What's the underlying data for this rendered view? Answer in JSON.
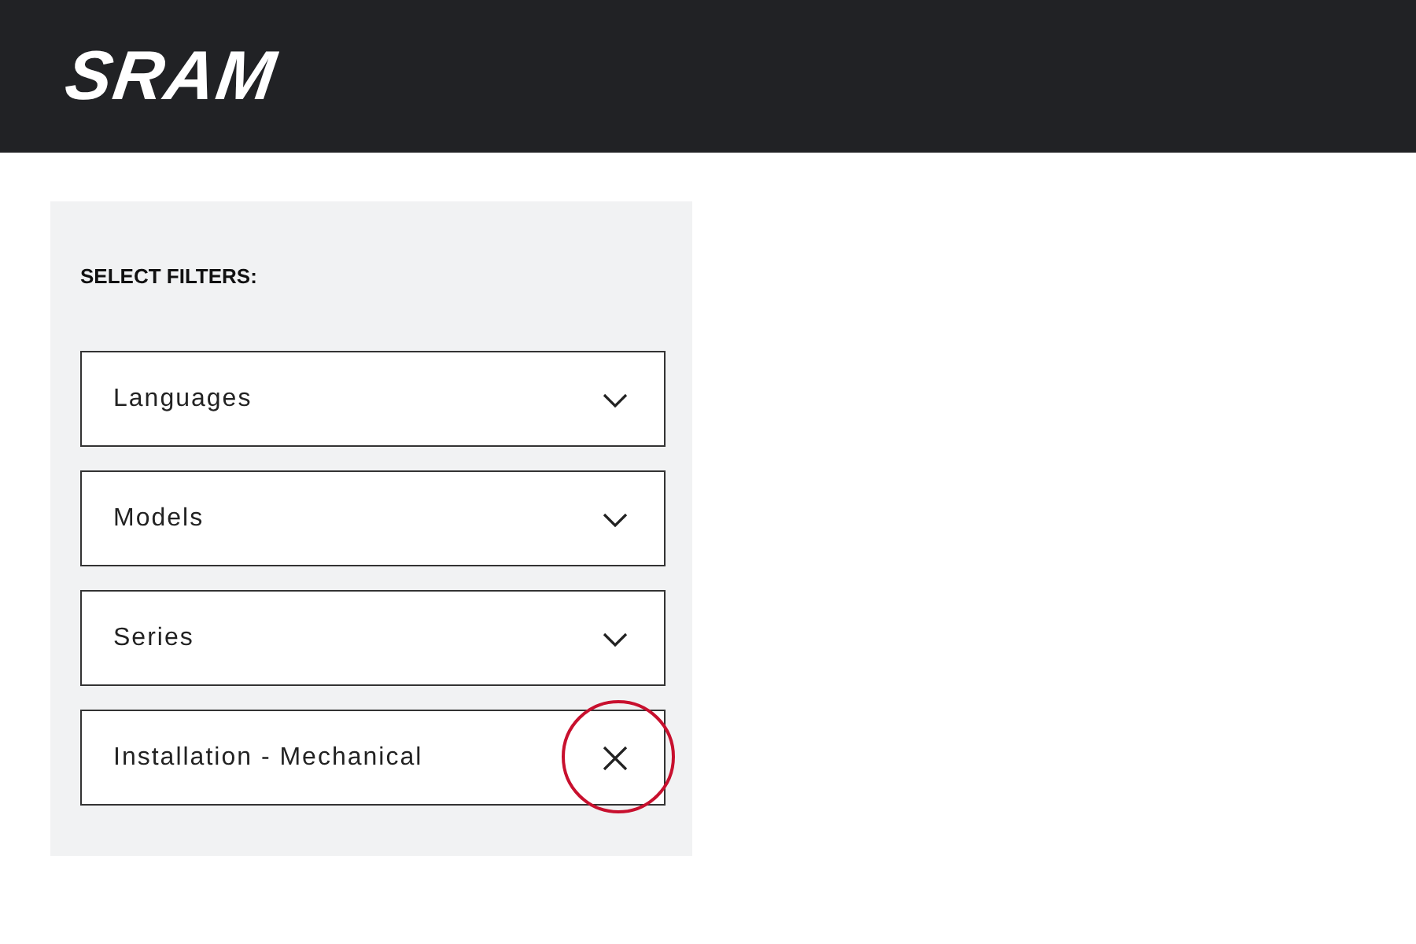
{
  "header": {
    "logo": "SRAM"
  },
  "filters": {
    "heading": "SELECT FILTERS:",
    "items": [
      {
        "label": "Languages",
        "kind": "dropdown"
      },
      {
        "label": "Models",
        "kind": "dropdown"
      },
      {
        "label": "Series",
        "kind": "dropdown"
      },
      {
        "label": "Installation - Mechanical",
        "kind": "applied"
      }
    ]
  }
}
